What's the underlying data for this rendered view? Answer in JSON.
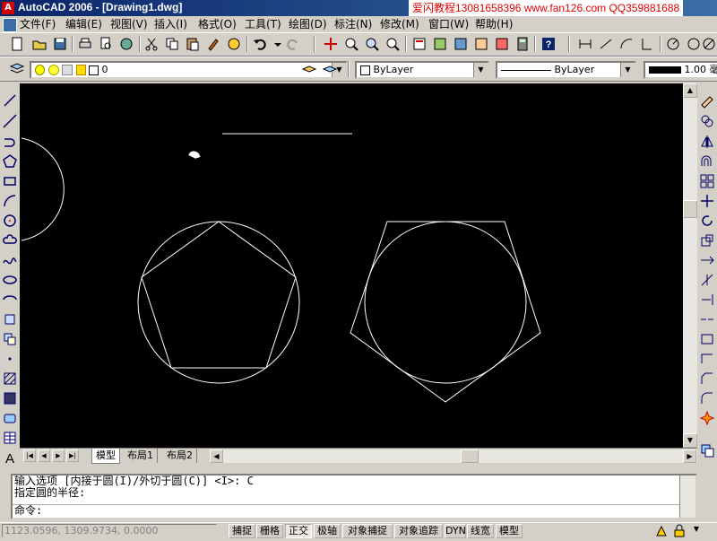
{
  "window": {
    "title": "AutoCAD 2006 - [Drawing1.dwg]",
    "app_icon": "autocad-icon"
  },
  "watermark": "爱闪教程13081658396 www.fan126.com QQ359881688",
  "menu": [
    "文件(F)",
    "编辑(E)",
    "视图(V)",
    "插入(I)",
    "格式(O)",
    "工具(T)",
    "绘图(D)",
    "标注(N)",
    "修改(M)",
    "窗口(W)",
    "帮助(H)"
  ],
  "layer_combo": {
    "value": "0"
  },
  "properties": {
    "color": "ByLayer",
    "linetype": "ByLayer",
    "lineweight": "1.00 毫"
  },
  "layout_tabs": [
    "模型",
    "布局1",
    "布局2"
  ],
  "active_tab": "模型",
  "command": {
    "lines": [
      "输入选项 [内接于圆(I)/外切于圆(C)] <I>: C",
      "指定圆的半径:",
      "命令:"
    ]
  },
  "status": {
    "coords": "1123.0596, 1309.9734, 0.0000",
    "toggles": [
      {
        "label": "捕捉",
        "on": false
      },
      {
        "label": "栅格",
        "on": false
      },
      {
        "label": "正交",
        "on": true
      },
      {
        "label": "极轴",
        "on": false
      },
      {
        "label": "对象捕捉",
        "on": false
      },
      {
        "label": "对象追踪",
        "on": false
      },
      {
        "label": "DYN",
        "on": false
      },
      {
        "label": "线宽",
        "on": false
      },
      {
        "label": "模型",
        "on": false
      }
    ]
  },
  "colors": {
    "canvas": "#000000",
    "geometry": "#ffffff",
    "titlebar": "#0a246a",
    "watermark": "#dd0000"
  }
}
